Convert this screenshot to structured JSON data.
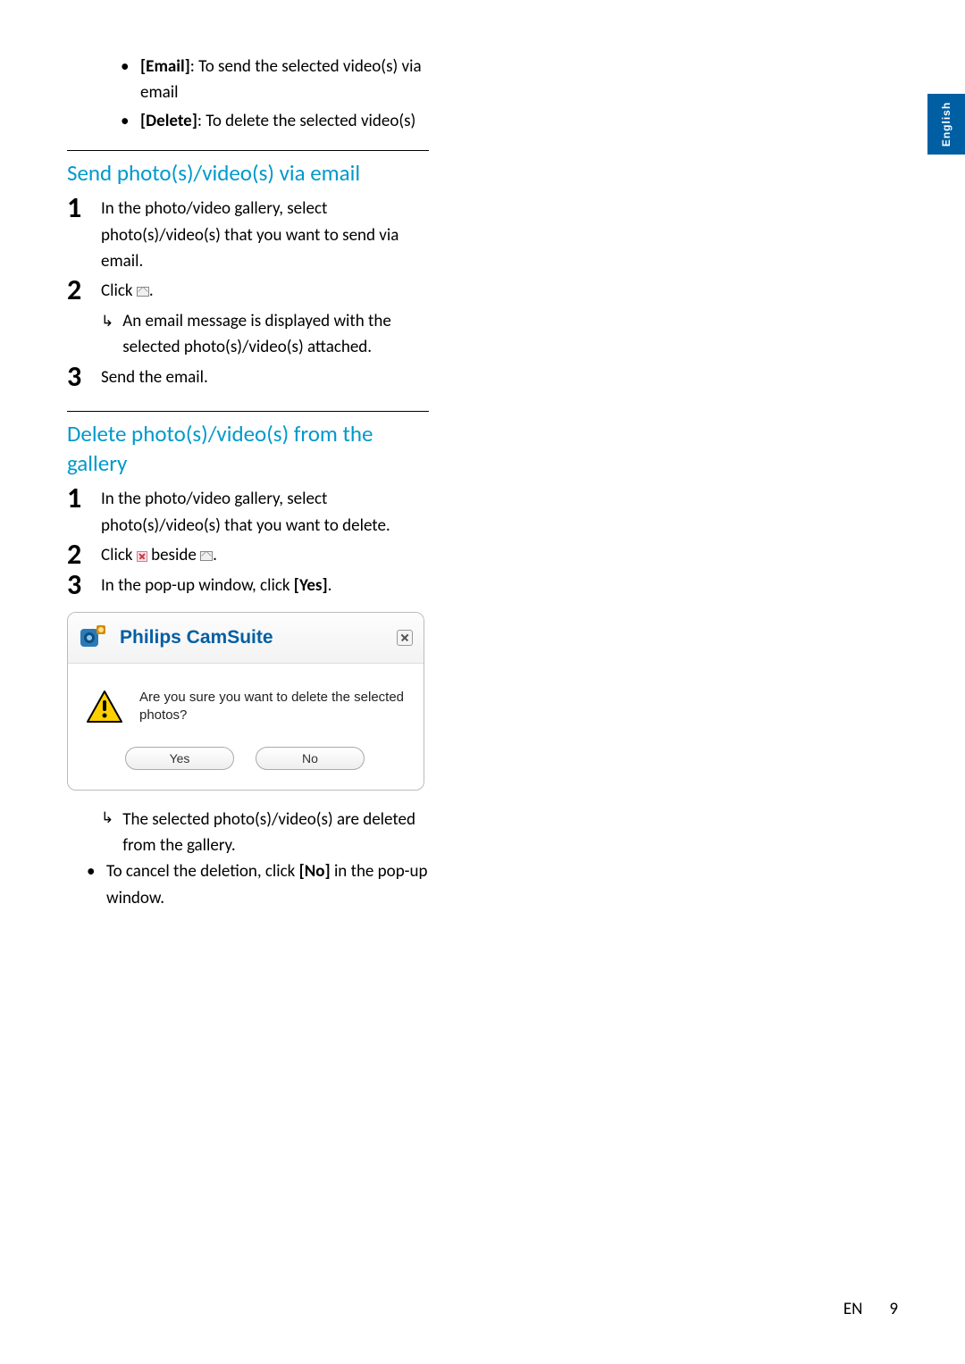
{
  "intro_bullets": [
    {
      "label": "[Email]",
      "desc": ": To send the selected video(s) via email"
    },
    {
      "label": "[Delete]",
      "desc": ": To delete the selected video(s)"
    }
  ],
  "email_section": {
    "heading": "Send photo(s)/video(s) via email",
    "steps": {
      "s1": "In the photo/video gallery, select photo(s)/video(s) that you want to send via email.",
      "s2_pre": "Click ",
      "s2_post": ".",
      "s2_result": "An email message is displayed with the selected photo(s)/video(s) attached.",
      "s3": "Send the email."
    }
  },
  "delete_section": {
    "heading": "Delete photo(s)/video(s) from the gallery",
    "steps": {
      "s1": "In the photo/video gallery, select photo(s)/video(s) that you want to delete.",
      "s2_pre": "Click ",
      "s2_mid": " beside ",
      "s2_post": ".",
      "s3_pre": "In the pop-up window, click ",
      "s3_bold": "[Yes]",
      "s3_post": "."
    },
    "result": "The selected photo(s)/video(s) are deleted from the gallery.",
    "cancel_pre": "To cancel the deletion, click ",
    "cancel_bold": "[No]",
    "cancel_post": " in the pop-up window."
  },
  "dialog": {
    "title": "Philips CamSuite",
    "message": "Are you sure you want to delete the selected photos?",
    "yes": "Yes",
    "no": "No"
  },
  "language": "English",
  "footer": {
    "lang": "EN",
    "page": "9"
  },
  "nums": {
    "n1": "1",
    "n2": "2",
    "n3": "3"
  }
}
